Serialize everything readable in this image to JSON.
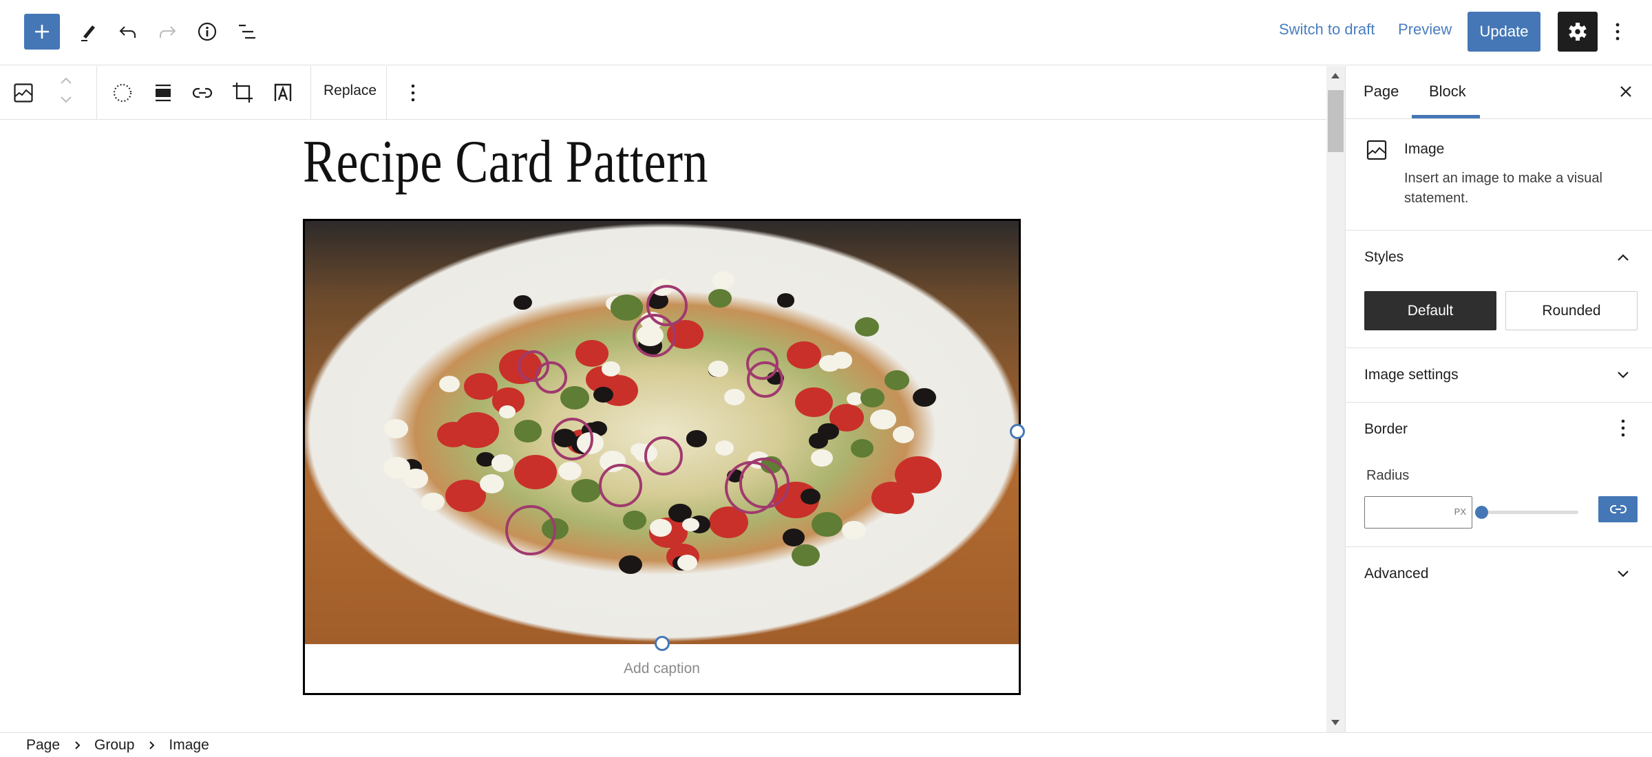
{
  "header": {
    "inserter_icon": "plus-icon",
    "tools_icon": "pencil-icon",
    "undo_icon": "undo-icon",
    "redo_icon": "redo-icon",
    "details_icon": "info-icon",
    "list_view_icon": "list-view-icon",
    "switch_to_draft": "Switch to draft",
    "preview": "Preview",
    "update": "Update",
    "settings_icon": "gear-icon",
    "options_icon": "kebab-icon"
  },
  "block_toolbar": {
    "block_type_icon": "image-icon",
    "move_up_icon": "chevron-up-icon",
    "move_down_icon": "chevron-down-icon",
    "duotone_icon": "duotone-icon",
    "align_icon": "align-wide-icon",
    "link_icon": "link-icon",
    "crop_icon": "crop-icon",
    "text_overlay_icon": "text-overlay-icon",
    "replace": "Replace",
    "more_icon": "kebab-icon"
  },
  "canvas": {
    "page_title": "Recipe Card Pattern",
    "image_alt": "Pizza with tomatoes, olives, red onion, artichoke and feta on a white plate",
    "caption_placeholder": "Add caption"
  },
  "sidebar": {
    "tabs": [
      {
        "label": "Page",
        "active": false
      },
      {
        "label": "Block",
        "active": true
      }
    ],
    "close_icon": "close-icon",
    "block_card": {
      "icon": "image-icon",
      "title": "Image",
      "description": "Insert an image to make a visual statement."
    },
    "styles": {
      "title": "Styles",
      "expanded": true,
      "options": [
        {
          "label": "Default",
          "selected": true
        },
        {
          "label": "Rounded",
          "selected": false
        }
      ]
    },
    "image_settings": {
      "title": "Image settings",
      "expanded": false
    },
    "border": {
      "title": "Border",
      "radius_label": "Radius",
      "radius_value": "",
      "radius_unit": "PX",
      "radius_slider_fraction": 0,
      "link_sides_icon": "link-icon"
    },
    "advanced": {
      "title": "Advanced",
      "expanded": false
    }
  },
  "footer": {
    "breadcrumbs": [
      "Page",
      "Group",
      "Image"
    ]
  },
  "colors": {
    "accent": "#4577b6",
    "dark": "#1e1e1e",
    "border": "#e0e0e0"
  }
}
